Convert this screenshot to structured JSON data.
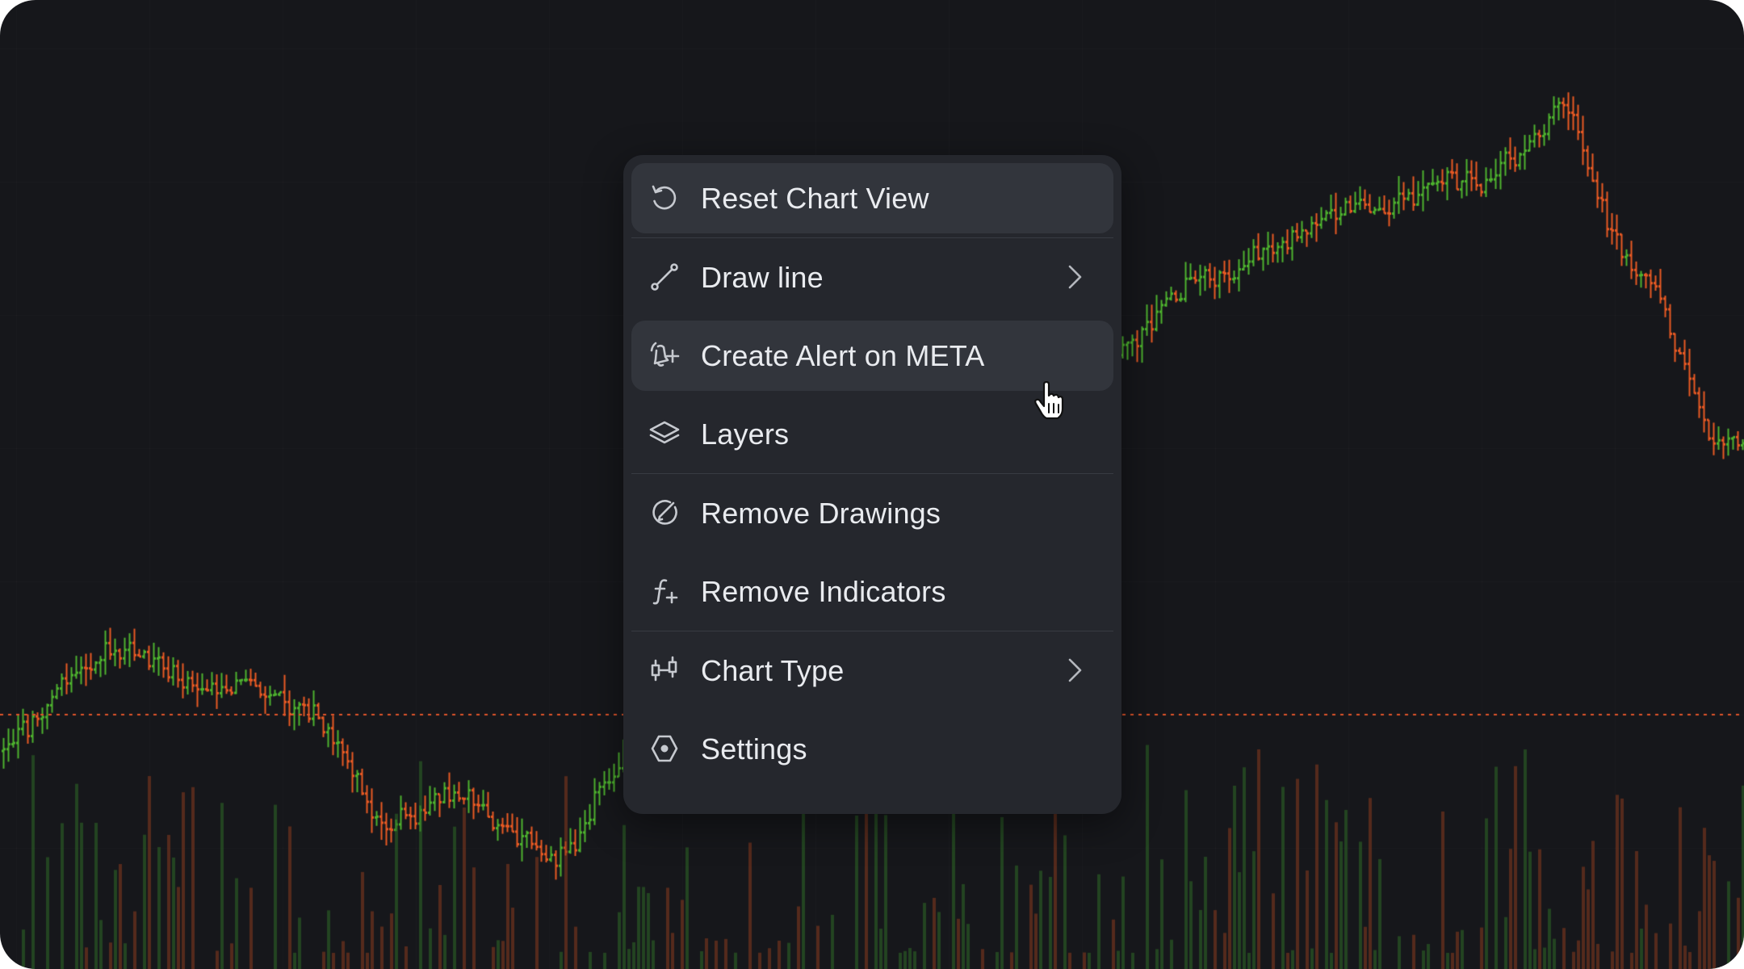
{
  "chart": {
    "up_color": "#4eb32f",
    "down_color": "#e85a24",
    "reference_line_color": "#e0542a"
  },
  "menu": {
    "items": [
      {
        "label": "Reset Chart View",
        "icon": "reset-icon"
      },
      {
        "label": "Draw line",
        "icon": "line-icon",
        "submenu": true
      },
      {
        "label": "Create Alert on META",
        "icon": "alert-add-icon"
      },
      {
        "label": "Layers",
        "icon": "layers-icon"
      },
      {
        "label": "Remove Drawings",
        "icon": "remove-drawings-icon"
      },
      {
        "label": "Remove Indicators",
        "icon": "remove-indicators-icon"
      },
      {
        "label": "Chart Type",
        "icon": "candles-icon",
        "submenu": true
      },
      {
        "label": "Settings",
        "icon": "settings-icon"
      }
    ]
  }
}
